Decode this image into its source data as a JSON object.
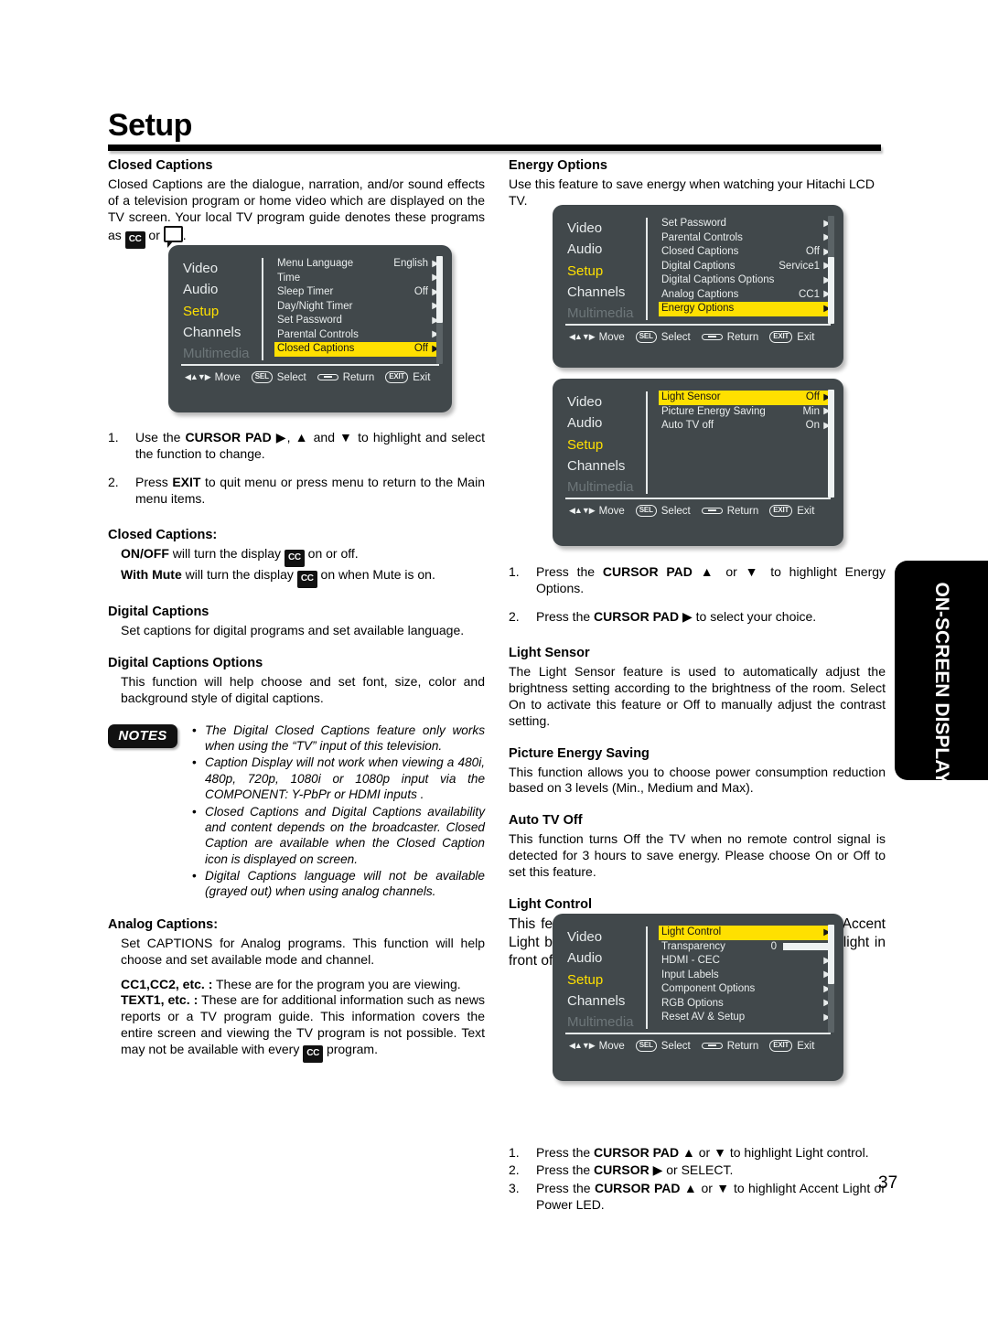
{
  "page": {
    "title": "Setup",
    "number": "37",
    "side_tab_label": "ON-SCREEN DISPLAY"
  },
  "left_column": {
    "closed_captions_heading": "Closed Captions",
    "closed_captions_intro_a": "Closed Captions are the dialogue, narration, and/or sound effects of a television program or home video which are displayed on the TV screen. Your local TV program guide denotes these programs as ",
    "closed_captions_intro_cc": "CC",
    "closed_captions_intro_or": " or ",
    "closed_captions_intro_end": ".",
    "steps": [
      {
        "num": "1.",
        "text_pre": "Use the ",
        "bold": "CURSOR PAD",
        "text_post": " ▶, ▲ and ▼ to highlight and select the function to change."
      },
      {
        "num": "2.",
        "text_pre": "Press ",
        "bold": "EXIT",
        "text_post": " to quit menu or press menu to return to the Main menu items."
      }
    ],
    "cc_subheading": "Closed Captions:",
    "cc_line1_bold": "ON/OFF",
    "cc_line1_mid": " will turn the display ",
    "cc_line1_end": " on or off.",
    "cc_line2_bold": "With Mute",
    "cc_line2_mid": " will turn the display ",
    "cc_line2_end": " on when Mute is on.",
    "digital_captions_heading": "Digital Captions",
    "digital_captions_body": "Set captions for digital programs and set available language.",
    "digital_captions_options_heading": "Digital Captions Options",
    "digital_captions_options_body": "This function will help choose and set font, size, color and background style of digital captions.",
    "notes_label": "NOTES",
    "notes": [
      "The Digital Closed Captions feature only works when using the “TV” input of this television.",
      "Caption Display will not work when viewing a 480i, 480p, 720p, 1080i or 1080p input via the COMPONENT: Y-PbPr or HDMI inputs .",
      "Closed Captions and Digital Captions availability and content depends on the broadcaster. Closed Caption are available when the Closed Caption icon is displayed on screen.",
      "Digital Captions language will not be available (grayed out) when using analog channels."
    ],
    "analog_captions_heading": "Analog Captions:",
    "analog_captions_body": "Set CAPTIONS for Analog programs. This function will help choose and set available mode and channel.",
    "cc12_bold": "CC1,CC2, etc. :",
    "cc12_text": " These are for the program you are viewing.",
    "text1_bold": "TEXT1, etc. :",
    "text1_text_a": " These are for additional information such as news reports or a TV program guide. This information covers the entire screen and viewing the TV program is not possible. Text may not be available with every ",
    "text1_text_b": " program."
  },
  "right_column": {
    "energy_options_heading": "Energy Options",
    "energy_options_body": "Use this feature to save energy when watching your Hitachi LCD TV.",
    "energy_steps": [
      {
        "num": "1.",
        "text_pre": "Press the ",
        "bold": "CURSOR PAD",
        "text_post": " ▲ or ▼ to highlight Energy Options."
      },
      {
        "num": "2.",
        "text_pre": "Press the ",
        "bold": "CURSOR PAD",
        "text_post": " ▶ to select your choice."
      }
    ],
    "light_sensor_heading": "Light Sensor",
    "light_sensor_body": "The Light Sensor feature is used to automatically adjust the brightness setting according to the brightness of the room.  Select On to activate this feature or Off to manually adjust the contrast setting.",
    "picture_energy_heading": "Picture Energy Saving",
    "picture_energy_body": "This function allows you to choose power consumption reduction based on 3 levels (Min., Medium and Max).",
    "auto_tv_off_heading": "Auto TV Off",
    "auto_tv_off_body": "This function turns Off the TV when no remote control signal is detected for 3 hours to save energy. Please choose On or Off to set this feature.",
    "light_control_heading": "Light Control",
    "light_control_body": "This feature allows you to adjust the ULTRAVSION Accent Light brightness and turn Off/On the LED indicating light in front of your LCD TV.",
    "light_control_steps": [
      {
        "num": "1.",
        "text_pre": "Press the ",
        "bold": "CURSOR PAD",
        "text_post": " ▲ or ▼ to highlight Light control."
      },
      {
        "num": "2.",
        "text_pre": "Press the ",
        "bold": "CURSOR",
        "text_post": " ▶ or SELECT."
      },
      {
        "num": "3.",
        "text_pre": "Press the ",
        "bold": "CURSOR PAD",
        "text_post": " ▲ or ▼ to highlight  Accent Light or Power LED."
      }
    ]
  },
  "osd_common": {
    "categories": [
      "Video",
      "Audio",
      "Setup",
      "Channels",
      "Multimedia"
    ],
    "active_category": "Setup",
    "dim_category": "Multimedia",
    "footer": {
      "move": "Move",
      "select": "Select",
      "return": "Return",
      "exit": "Exit",
      "sel_key": "SEL",
      "exit_key": "EXIT"
    },
    "colors": {
      "panel": "#41484b",
      "highlight": "#ffe000",
      "active_text": "#ffe000",
      "dim_text": "#6d7679"
    }
  },
  "osd_menus": [
    {
      "id": "setup-closed-captions-menu",
      "rows": [
        {
          "label": "Menu Language",
          "value": "English",
          "arrow": "▶",
          "highlight": false
        },
        {
          "label": "Time",
          "value": "",
          "arrow": "▶",
          "highlight": false
        },
        {
          "label": "Sleep Timer",
          "value": "Off",
          "arrow": "▶",
          "highlight": false
        },
        {
          "label": "Day/Night Timer",
          "value": "",
          "arrow": "▶",
          "highlight": false
        },
        {
          "label": "Set Password",
          "value": "",
          "arrow": "▶",
          "highlight": false
        },
        {
          "label": "Parental Controls",
          "value": "",
          "arrow": "▶",
          "highlight": false
        },
        {
          "label": "Closed Captions",
          "value": "Off",
          "arrow": "▶",
          "highlight": true
        }
      ],
      "scroll_thumb_top_pct": 0,
      "scroll_thumb_height_pct": 62
    },
    {
      "id": "setup-energy-options-menu",
      "rows": [
        {
          "label": "Set Password",
          "value": "",
          "arrow": "▶",
          "highlight": false
        },
        {
          "label": "Parental Controls",
          "value": "",
          "arrow": "▶",
          "highlight": false
        },
        {
          "label": "Closed Captions",
          "value": "Off",
          "arrow": "▶",
          "highlight": false
        },
        {
          "label": "Digital Captions",
          "value": "Service1",
          "arrow": "▶",
          "highlight": false
        },
        {
          "label": "Digital Captions Options",
          "value": "",
          "arrow": "▶",
          "highlight": false
        },
        {
          "label": "Analog Captions",
          "value": "CC1",
          "arrow": "▶",
          "highlight": false
        },
        {
          "label": "Energy Options",
          "value": "",
          "arrow": "▶",
          "highlight": true
        }
      ],
      "scroll_thumb_top_pct": 38,
      "scroll_thumb_height_pct": 62
    },
    {
      "id": "energy-options-submenu",
      "rows": [
        {
          "label": "Light Sensor",
          "value": "Off",
          "arrow": "▶",
          "highlight": true
        },
        {
          "label": "Picture Energy Saving",
          "value": "Min",
          "arrow": "▶",
          "highlight": false
        },
        {
          "label": "Auto TV off",
          "value": "On",
          "arrow": "▶",
          "highlight": false
        }
      ],
      "scroll_thumb_top_pct": 0,
      "scroll_thumb_height_pct": 100
    },
    {
      "id": "light-control-menu",
      "rows": [
        {
          "label": "Light Control",
          "value": "",
          "arrow": "▶",
          "highlight": true
        },
        {
          "label": "Transparency",
          "value": "0",
          "arrow": "slider",
          "highlight": false
        },
        {
          "label": "HDMI - CEC",
          "value": "",
          "arrow": "▶",
          "highlight": false
        },
        {
          "label": "Input Labels",
          "value": "",
          "arrow": "▶",
          "highlight": false
        },
        {
          "label": "Component Options",
          "value": "",
          "arrow": "▶",
          "highlight": false
        },
        {
          "label": "RGB Options",
          "value": "",
          "arrow": "▶",
          "highlight": false
        },
        {
          "label": "Reset AV & Setup",
          "value": "",
          "arrow": "▶",
          "highlight": false
        }
      ],
      "scroll_thumb_top_pct": 0,
      "scroll_thumb_height_pct": 55
    }
  ]
}
